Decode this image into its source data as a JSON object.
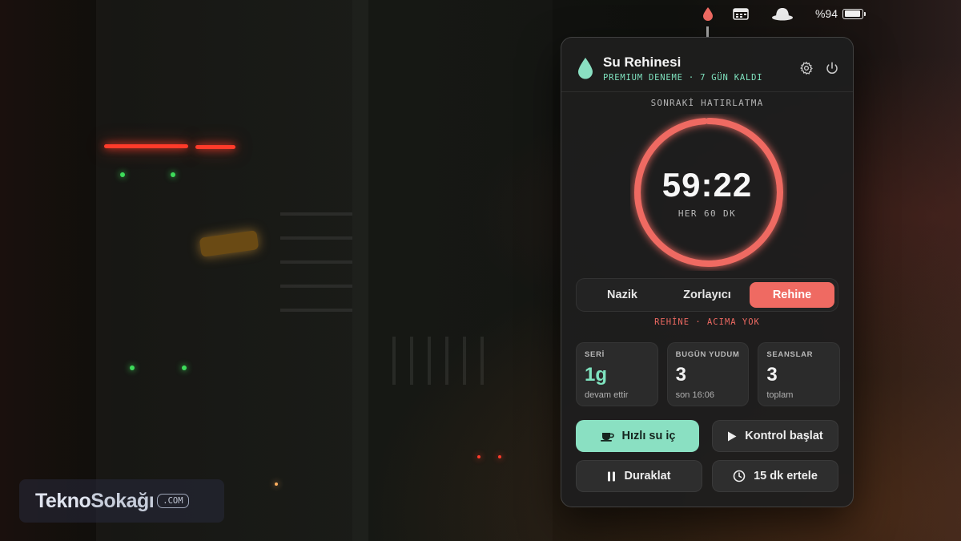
{
  "menubar": {
    "battery_text": "%94",
    "battery_level": 0.94,
    "icons": [
      "water-drop-icon",
      "calendar-icon",
      "hat-icon",
      "battery-icon"
    ]
  },
  "app": {
    "title": "Su Rehinesi",
    "subtitle": "PREMIUM DENEME · 7 GÜN KALDI",
    "icons": [
      "gear-icon",
      "power-icon"
    ]
  },
  "timer": {
    "label": "SONRAKİ HATIRLATMA",
    "value": "59:22",
    "interval": "HER 60 DK",
    "progress": 0.99
  },
  "modes": {
    "items": [
      "Nazik",
      "Zorlayıcı",
      "Rehine"
    ],
    "active": "Rehine",
    "caption": "REHİNE · ACIMA YOK"
  },
  "stats": [
    {
      "label": "SERİ",
      "value": "1g",
      "sub": "devam ettir"
    },
    {
      "label": "BUGÜN YUDUM",
      "value": "3",
      "sub": "son 16:06"
    },
    {
      "label": "SEANSLAR",
      "value": "3",
      "sub": "toplam"
    }
  ],
  "actions": {
    "quick_drink": "Hızlı su iç",
    "start_check": "Kontrol başlat",
    "pause": "Duraklat",
    "snooze": "15 dk ertele"
  },
  "watermark": {
    "brand_a": "Tekno",
    "brand_b": "Sokağı",
    "suffix": ".COM"
  },
  "colors": {
    "accent_red": "#ef6a62",
    "accent_green": "#8ae0c2",
    "panel_bg": "#1e1e1e"
  }
}
